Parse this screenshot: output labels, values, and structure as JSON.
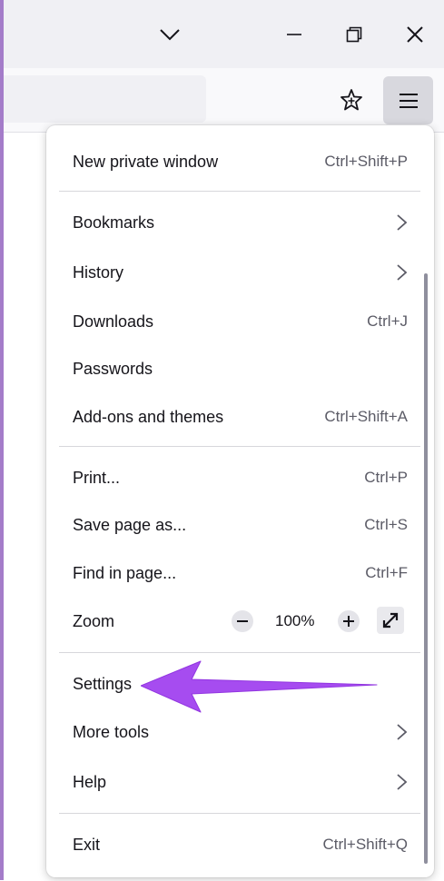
{
  "window": {
    "icons": {
      "tabs_dropdown": "chevron-down-icon",
      "minimize": "minimize-icon",
      "restore": "restore-icon",
      "close": "close-icon"
    }
  },
  "toolbar": {
    "icons": {
      "bookmark_star": "star-icon",
      "app_menu": "hamburger-menu-icon"
    }
  },
  "menu": {
    "new_private_window": {
      "label": "New private window",
      "shortcut": "Ctrl+Shift+P"
    },
    "bookmarks": {
      "label": "Bookmarks"
    },
    "history": {
      "label": "History"
    },
    "downloads": {
      "label": "Downloads",
      "shortcut": "Ctrl+J"
    },
    "passwords": {
      "label": "Passwords"
    },
    "addons": {
      "label": "Add-ons and themes",
      "shortcut": "Ctrl+Shift+A"
    },
    "print": {
      "label": "Print...",
      "shortcut": "Ctrl+P"
    },
    "save_page": {
      "label": "Save page as...",
      "shortcut": "Ctrl+S"
    },
    "find": {
      "label": "Find in page...",
      "shortcut": "Ctrl+F"
    },
    "zoom": {
      "label": "Zoom",
      "value": "100%",
      "minus": "−",
      "plus": "+"
    },
    "settings": {
      "label": "Settings"
    },
    "more_tools": {
      "label": "More tools"
    },
    "help": {
      "label": "Help"
    },
    "exit": {
      "label": "Exit",
      "shortcut": "Ctrl+Shift+Q"
    }
  },
  "annotation": {
    "arrow_color": "#a64cf0",
    "icon": "pointer-arrow-icon"
  },
  "colors": {
    "accent_panel_bg": "#ffffff",
    "window_bg": "#f0f0f4",
    "menu_button_bg": "#d8d8de"
  }
}
